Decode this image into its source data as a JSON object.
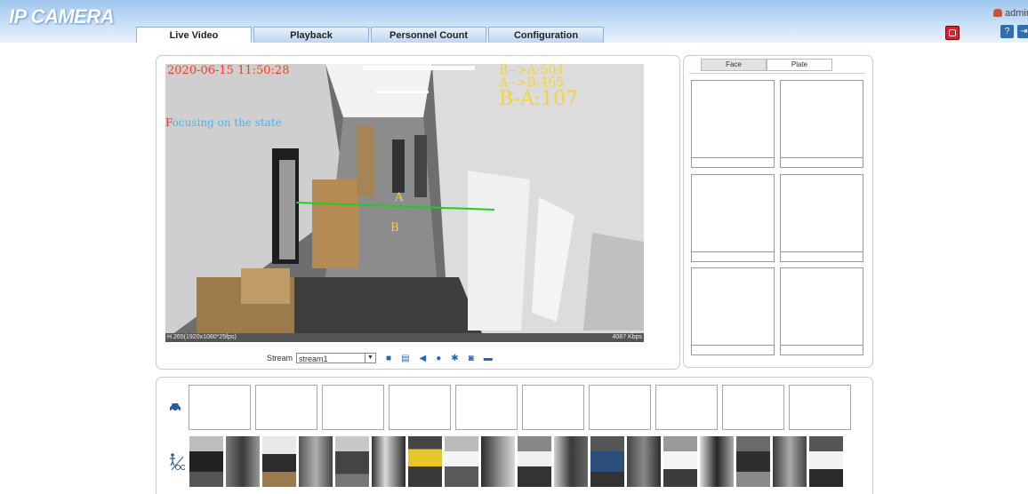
{
  "app": {
    "logo": "IP CAMERA",
    "user": "admin"
  },
  "tabs": [
    {
      "label": "Live Video",
      "active": true
    },
    {
      "label": "Playback",
      "active": false
    },
    {
      "label": "Personnel Count",
      "active": false
    },
    {
      "label": "Configuration",
      "active": false
    }
  ],
  "video": {
    "timestamp": "2020-06-15 11:50:28",
    "count_b_to_a": "B-->A:504",
    "count_a_to_b": "A-->B:465",
    "count_diff": "B-A:107",
    "focus_status": "Focusing on the state",
    "line_label_a": "A",
    "line_label_b": "B",
    "codec_info": "H.265(1920x1080*25fps)",
    "bitrate": "4087 Kbps"
  },
  "controls": {
    "stream_label": "Stream",
    "stream_value": "stream1",
    "icons": [
      "stop-icon",
      "record-icon",
      "audio-icon",
      "talk-icon",
      "settings-icon",
      "snapshot-icon",
      "fullscreen-icon"
    ]
  },
  "capture_panel": {
    "tabs": [
      {
        "label": "Face",
        "active": true
      },
      {
        "label": "Plate",
        "active": false
      }
    ]
  },
  "bottom_panel": {
    "vehicle_icon": "car-icon",
    "pedestrian_icon": "pedestrian-bike-icon",
    "vehicle_slots": 10,
    "person_thumbnails": 18
  },
  "colors": {
    "timestamp": "#ff3b1f",
    "counts": "#f2d33a",
    "focus_first": "#ff3030",
    "focus_rest": "#4ab6f2",
    "count_line": "#1ecf1e",
    "accent": "#2567b5",
    "alarm": "#e11e2b"
  }
}
